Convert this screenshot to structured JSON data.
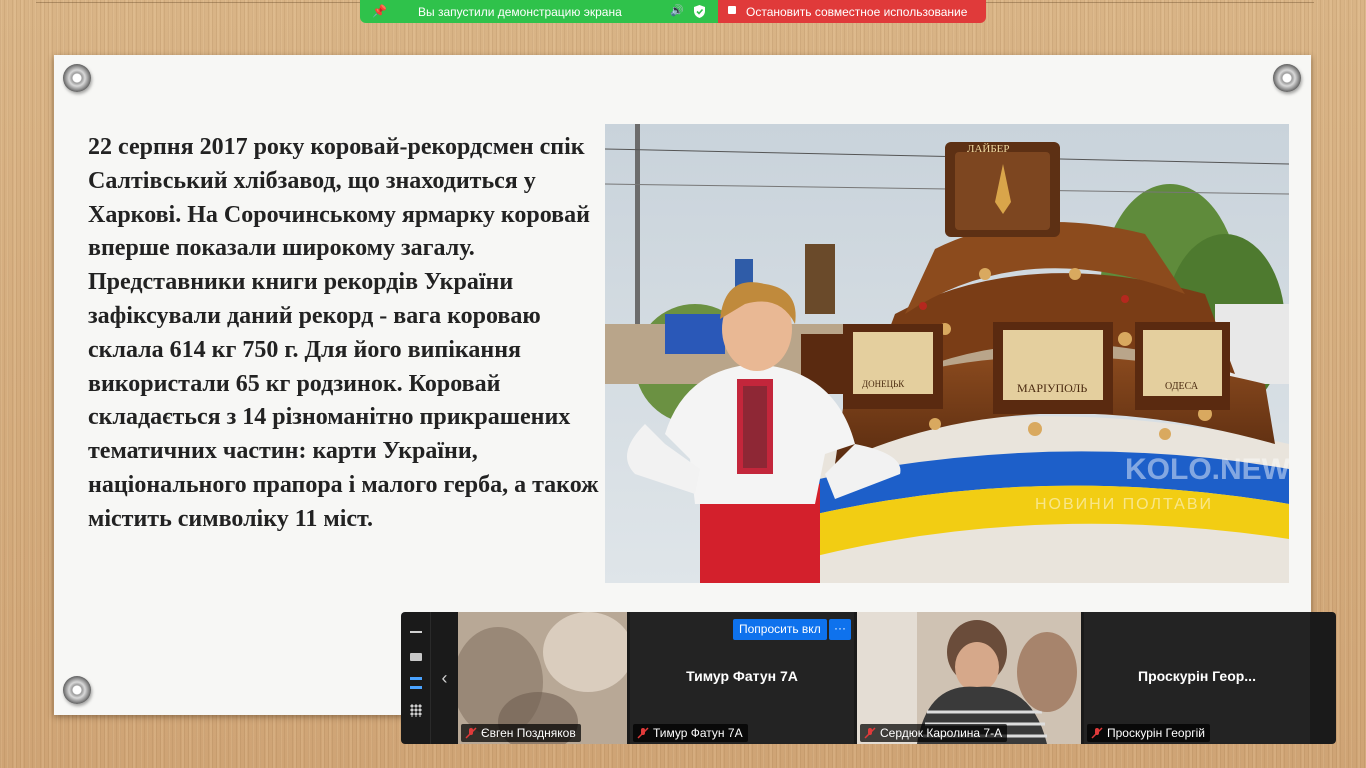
{
  "share_bar": {
    "status_text": "Вы запустили демонстрацию экрана",
    "stop_text": "Остановить совместное использование",
    "colors": {
      "status_bg": "#2fc24b",
      "stop_bg": "#e03a3a"
    }
  },
  "slide": {
    "text": "22 серпня 2017 року коровай-рекордсмен спік Салтівський хлібзавод, що знаходиться у Харкові. На Сорочинському ярмарку коровай вперше показали широкому загалу. Представники книги рекордів України зафіксували даний рекорд - вага короваю склала 614 кг 750 г. Для його випікання використали 65 кг родзинок. Коровай складається з 14 різноманітно прикрашених тематичних частин: карти України, національного прапора і малого герба, а також містить символіку 11 міст.",
    "photo": {
      "sign_top": "ЛАЙБЕР",
      "plaque_center": "МАРІУПОЛЬ",
      "plaque_left": "ДОНЕЦЬК",
      "plaque_right": "ОДЕСА",
      "watermark_main": "KOLO.NEWS",
      "watermark_sub": "НОВИНИ ПОЛТАВИ"
    }
  },
  "gallery": {
    "prev_icon": "chevron-left-icon",
    "ask_button": "Попросить вкл",
    "more_button": "···",
    "participants": [
      {
        "name": "Євген Поздняков",
        "muted": true,
        "video": true
      },
      {
        "name": "Тимур Фатун 7А",
        "display": "Тимур Фатун 7А",
        "muted": true,
        "video": false
      },
      {
        "name": "Сердюк Каролина 7-А",
        "muted": true,
        "video": true
      },
      {
        "name": "Проскурін Георгій",
        "display": "Проскурін Геор...",
        "muted": true,
        "video": false
      }
    ],
    "accent": "#0e72ed"
  }
}
